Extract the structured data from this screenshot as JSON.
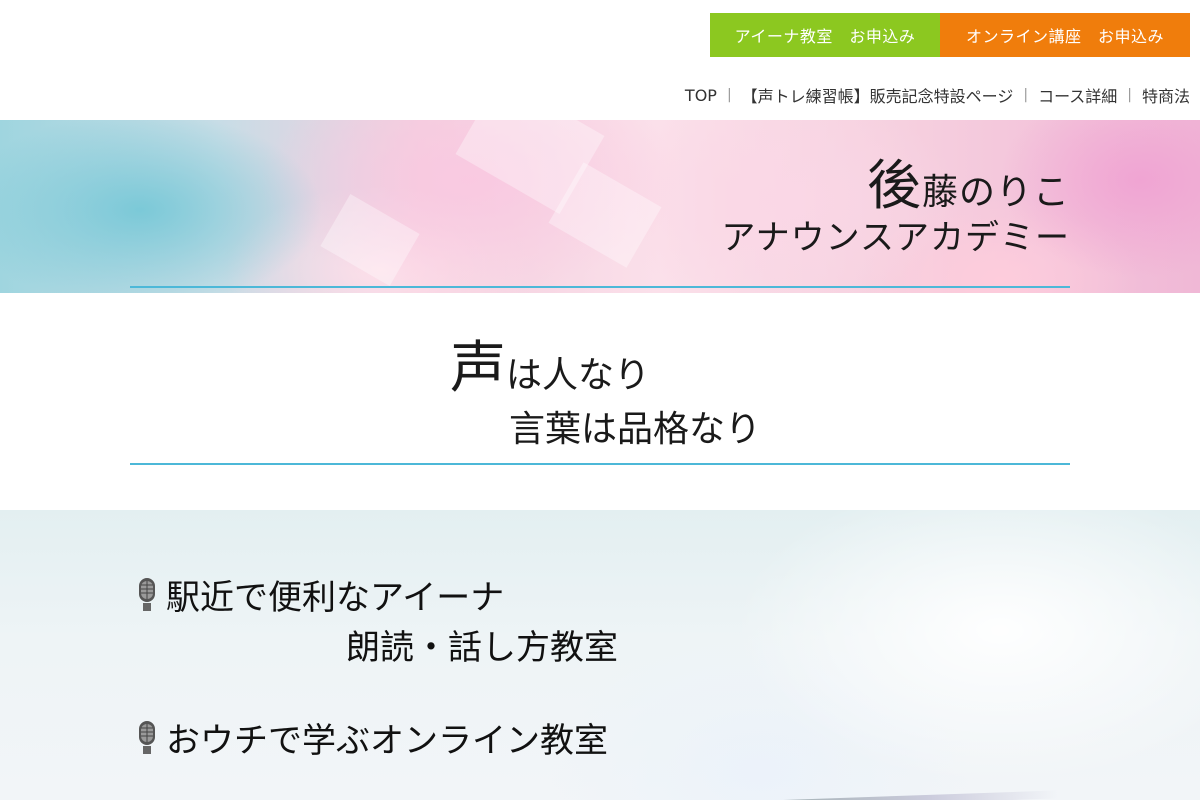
{
  "header": {
    "cta_buttons": [
      {
        "label": "アイーナ教室　お申込み",
        "color": "#8cc820"
      },
      {
        "label": "オンライン講座　お申込み",
        "color": "#f07d0c"
      }
    ],
    "nav": [
      {
        "label": "TOP"
      },
      {
        "label": "【声トレ練習帳】販売記念特設ページ"
      },
      {
        "label": "コース詳細"
      },
      {
        "label": "特商法"
      }
    ],
    "nav_separator": "|"
  },
  "hero": {
    "name_first_char": "後",
    "name_rest": "藤のりこ",
    "subtitle": "アナウンスアカデミー"
  },
  "motto": {
    "line1_big": "声",
    "line1_rest": "は人なり",
    "line2": "言葉は品格なり"
  },
  "courses": {
    "item1_line1": "駅近で便利なアイーナ",
    "item1_line2": "朗読・話し方教室",
    "item2": "おウチで学ぶオンライン教室",
    "icon": "microphone-icon"
  },
  "colors": {
    "accent_line": "#4cb8d8",
    "green": "#8cc820",
    "orange": "#f07d0c"
  }
}
